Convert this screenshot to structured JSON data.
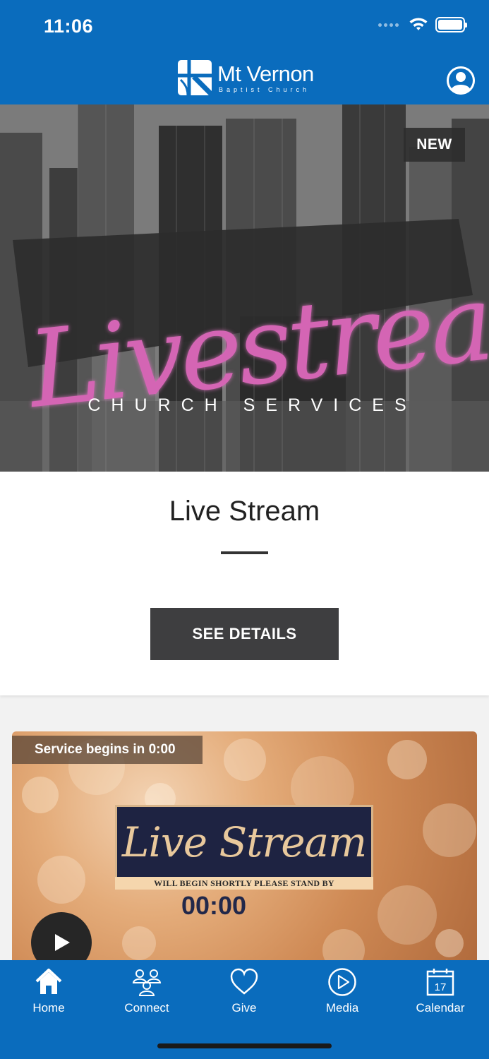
{
  "status_bar": {
    "time": "11:06",
    "icons": [
      "signal-dots-icon",
      "wifi-icon",
      "battery-icon"
    ]
  },
  "header": {
    "logo_name": "Mt Vernon",
    "logo_subtitle": "Baptist Church",
    "profile_icon": "user-circle-icon",
    "background_color": "#0a6cbd"
  },
  "hero": {
    "badge": "NEW",
    "script_title": "Livestream",
    "subtitle": "CHURCH SERVICES"
  },
  "info_card": {
    "title": "Live Stream",
    "button_label": "SEE DETAILS"
  },
  "video_card": {
    "status_label": "Service begins in 0:00",
    "graphic_title": "Live Stream",
    "graphic_banner": "WILL BEGIN SHORTLY  PLEASE STAND BY",
    "graphic_countdown": "00:00",
    "play_icon": "play-icon"
  },
  "tabbar": {
    "tabs": [
      {
        "label": "Home",
        "icon": "home-icon"
      },
      {
        "label": "Connect",
        "icon": "people-icon"
      },
      {
        "label": "Give",
        "icon": "heart-icon"
      },
      {
        "label": "Media",
        "icon": "play-circle-icon"
      },
      {
        "label": "Calendar",
        "icon": "calendar-icon",
        "icon_text": "17"
      }
    ],
    "background_color": "#0a6cbd"
  }
}
